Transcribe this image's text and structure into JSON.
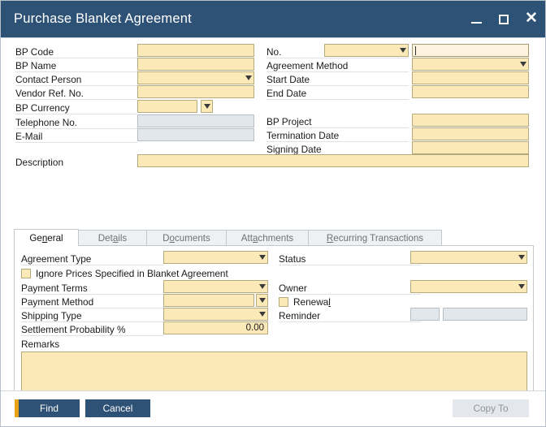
{
  "window": {
    "title": "Purchase Blanket Agreement",
    "controls": [
      {
        "name": "minimize",
        "glyph": "_"
      },
      {
        "name": "maximize",
        "glyph": "□"
      },
      {
        "name": "close",
        "glyph": "✕"
      }
    ]
  },
  "header": {
    "left_fields": [
      {
        "label": "BP Code",
        "value": "",
        "type": "text"
      },
      {
        "label": "BP Name",
        "value": "",
        "type": "text"
      },
      {
        "label": "Contact Person",
        "value": "",
        "type": "combo"
      },
      {
        "label": "Vendor Ref. No.",
        "value": "",
        "type": "text"
      },
      {
        "label": "BP Currency",
        "value": "",
        "type": "text-dropbtn"
      },
      {
        "label": "Telephone No.",
        "value": "",
        "type": "disabled"
      },
      {
        "label": "E-Mail",
        "value": "",
        "type": "disabled"
      }
    ],
    "right_fields": [
      {
        "label": "No.",
        "value": "",
        "type": "combo-plus-input",
        "value2": ""
      },
      {
        "label": "Agreement Method",
        "value": "",
        "type": "combo"
      },
      {
        "label": "Start Date",
        "value": "",
        "type": "text"
      },
      {
        "label": "End Date",
        "value": "",
        "type": "text"
      },
      {
        "label": "BP Project",
        "value": "",
        "type": "text"
      },
      {
        "label": "Termination Date",
        "value": "",
        "type": "text"
      },
      {
        "label": "Signing Date",
        "value": "",
        "type": "text"
      }
    ],
    "description": {
      "label": "Description",
      "value": ""
    }
  },
  "tabs": [
    {
      "label": "General",
      "mnemonic_index": 2,
      "active": true
    },
    {
      "label": "Details",
      "mnemonic_index": 4,
      "active": false
    },
    {
      "label": "Documents",
      "mnemonic_index": 1,
      "active": false
    },
    {
      "label": "Attachments",
      "mnemonic_index": 3,
      "active": false
    },
    {
      "label": "Recurring Transactions",
      "mnemonic_index": 0,
      "active": false
    }
  ],
  "general_tab": {
    "left": {
      "agreement_type": {
        "label": "Agreement Type",
        "value": ""
      },
      "ignore_prices": {
        "label": "Ignore Prices Specified in Blanket Agreement",
        "checked": false,
        "mnemonic_index": 1
      },
      "payment_terms": {
        "label": "Payment Terms",
        "value": ""
      },
      "payment_method": {
        "label": "Payment Method",
        "value": ""
      },
      "shipping_type": {
        "label": "Shipping Type",
        "value": ""
      },
      "settlement_prob": {
        "label": "Settlement Probability %",
        "value": "0.00"
      },
      "remarks": {
        "label": "Remarks",
        "value": ""
      }
    },
    "right": {
      "status": {
        "label": "Status",
        "value": ""
      },
      "owner": {
        "label": "Owner",
        "value": ""
      },
      "renewal": {
        "label": "Renewal",
        "checked": false,
        "mnemonic_index": 6
      },
      "reminder": {
        "label": "Reminder",
        "value": "",
        "value2": ""
      }
    }
  },
  "footer": {
    "find_label": "Find",
    "cancel_label": "Cancel",
    "copy_to_label": "Copy To"
  },
  "colors": {
    "titlebar": "#2e5275",
    "field_yellow": "#fce9b8",
    "field_disabled": "#e2e7ec",
    "accent_orange": "#e8a317",
    "button_navy": "#2e5275"
  }
}
